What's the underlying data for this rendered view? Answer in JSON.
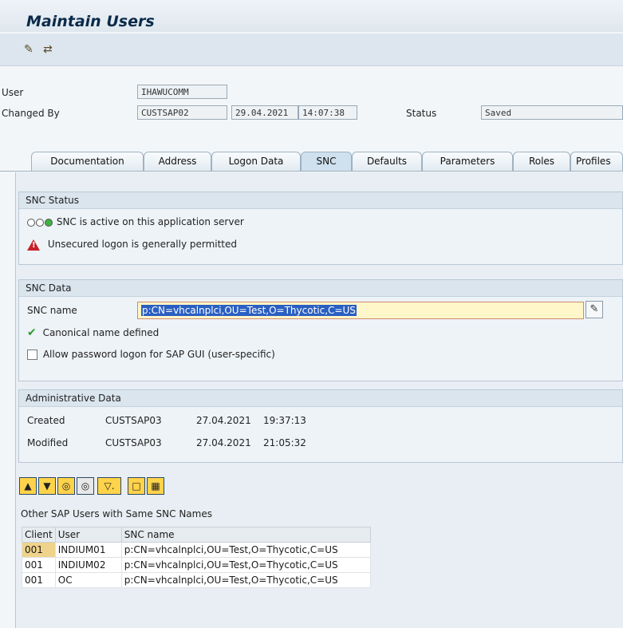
{
  "app": {
    "title": "Maintain Users"
  },
  "toolbar": {
    "icons": [
      "edit-glasses-icon",
      "change-icon"
    ]
  },
  "header": {
    "user_label": "User",
    "user_value": "IHAWUCOMM",
    "changed_by_label": "Changed By",
    "changed_by_value": "CUSTSAP02",
    "changed_date": "29.04.2021",
    "changed_time": "14:07:38",
    "status_label": "Status",
    "status_value": "Saved"
  },
  "tabs": [
    {
      "label": "Documentation"
    },
    {
      "label": "Address"
    },
    {
      "label": "Logon Data"
    },
    {
      "label": "SNC",
      "active": true
    },
    {
      "label": "Defaults"
    },
    {
      "label": "Parameters"
    },
    {
      "label": "Roles"
    },
    {
      "label": "Profiles"
    }
  ],
  "snc_status": {
    "title": "SNC Status",
    "line1": "SNC is active on this application server",
    "line2": "Unsecured logon is generally permitted"
  },
  "snc_data": {
    "title": "SNC Data",
    "name_label": "SNC name",
    "name_value": "p:CN=vhcalnplci,OU=Test,O=Thycotic,C=US",
    "canonical": "Canonical name defined",
    "allow_pw": "Allow password logon for SAP GUI (user-specific)"
  },
  "admin": {
    "title": "Administrative Data",
    "created_label": "Created",
    "created_by": "CUSTSAP03",
    "created_date": "27.04.2021",
    "created_time": "19:37:13",
    "modified_label": "Modified",
    "modified_by": "CUSTSAP03",
    "modified_date": "27.04.2021",
    "modified_time": "21:05:32"
  },
  "alv": {
    "title": "Other SAP Users with Same SNC Names",
    "columns": [
      "Client",
      "User",
      "SNC name"
    ],
    "rows": [
      [
        "001",
        "INDIUM01",
        "p:CN=vhcalnplci,OU=Test,O=Thycotic,C=US"
      ],
      [
        "001",
        "INDIUM02",
        "p:CN=vhcalnplci,OU=Test,O=Thycotic,C=US"
      ],
      [
        "001",
        "OC",
        "p:CN=vhcalnplci,OU=Test,O=Thycotic,C=US"
      ]
    ]
  }
}
